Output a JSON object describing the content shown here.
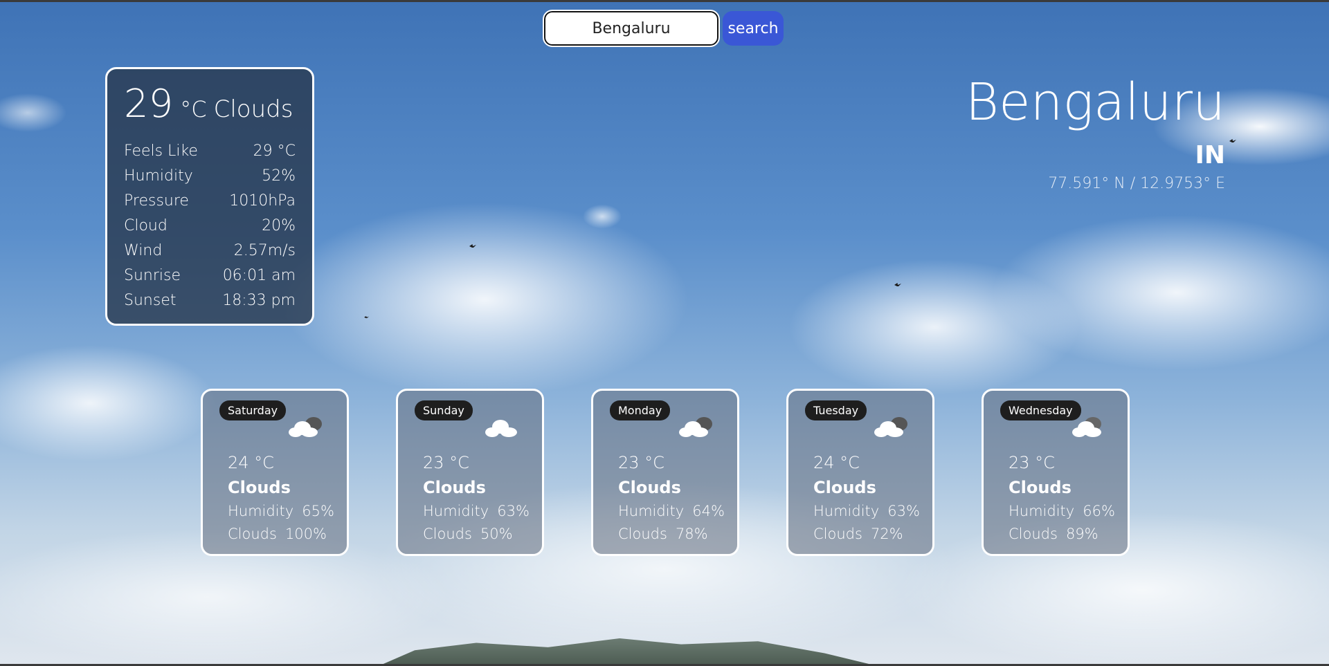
{
  "search": {
    "value": "Bengaluru",
    "button_label": "search"
  },
  "current": {
    "temp": "29",
    "unit": "°C",
    "condition": "Clouds",
    "details": [
      {
        "label": "Feels Like",
        "value": "29 °C"
      },
      {
        "label": "Humidity",
        "value": "52%"
      },
      {
        "label": "Pressure",
        "value": "1010hPa"
      },
      {
        "label": "Cloud",
        "value": "20%"
      },
      {
        "label": "Wind",
        "value": "2.57m/s"
      },
      {
        "label": "Sunrise",
        "value": "06:01 am"
      },
      {
        "label": "Sunset",
        "value": "18:33 pm"
      }
    ]
  },
  "location": {
    "city": "Bengaluru",
    "country": "IN",
    "coords": "77.591° N / 12.9753° E"
  },
  "forecast": [
    {
      "day": "Saturday",
      "temp": "24 °C",
      "condition": "Clouds",
      "humidity_label": "Humidity",
      "humidity": "65%",
      "clouds_label": "Clouds",
      "clouds": "100%",
      "icon": "broken-clouds-icon"
    },
    {
      "day": "Sunday",
      "temp": "23 °C",
      "condition": "Clouds",
      "humidity_label": "Humidity",
      "humidity": "63%",
      "clouds_label": "Clouds",
      "clouds": "50%",
      "icon": "scattered-clouds-icon"
    },
    {
      "day": "Monday",
      "temp": "23 °C",
      "condition": "Clouds",
      "humidity_label": "Humidity",
      "humidity": "64%",
      "clouds_label": "Clouds",
      "clouds": "78%",
      "icon": "broken-clouds-icon"
    },
    {
      "day": "Tuesday",
      "temp": "24 °C",
      "condition": "Clouds",
      "humidity_label": "Humidity",
      "humidity": "63%",
      "clouds_label": "Clouds",
      "clouds": "72%",
      "icon": "broken-clouds-icon"
    },
    {
      "day": "Wednesday",
      "temp": "23 °C",
      "condition": "Clouds",
      "humidity_label": "Humidity",
      "humidity": "66%",
      "clouds_label": "Clouds",
      "clouds": "89%",
      "icon": "overcast-clouds-icon"
    }
  ],
  "colors": {
    "accent": "#3a57d6",
    "card_border": "#ffffff"
  }
}
